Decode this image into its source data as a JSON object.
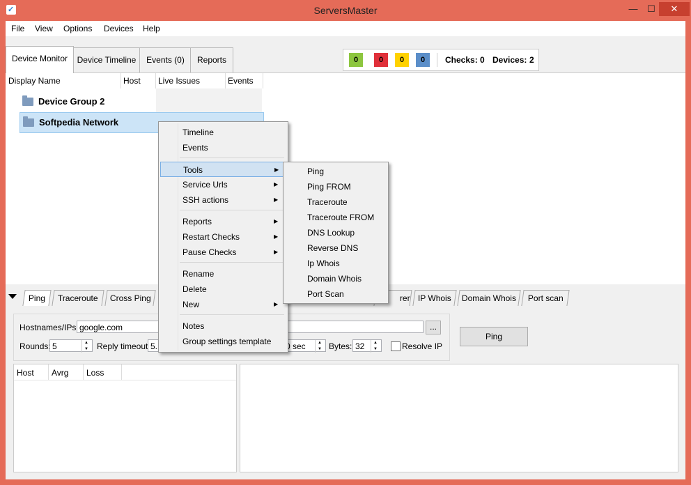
{
  "window": {
    "title": "ServersMaster"
  },
  "menubar": {
    "items": [
      "File",
      "View",
      "Options",
      "Devices",
      "Help"
    ]
  },
  "tabs": [
    {
      "label": "Device Monitor",
      "active": true
    },
    {
      "label": "Device Timeline",
      "active": false
    },
    {
      "label": "Events (0)",
      "active": false
    },
    {
      "label": "Reports",
      "active": false
    }
  ],
  "status": {
    "badges": [
      {
        "value": "0",
        "color": "#8dc63f"
      },
      {
        "value": "0",
        "color": "#e0303a"
      },
      {
        "value": "0",
        "color": "#ffd200"
      },
      {
        "value": "0",
        "color": "#5b8ec9"
      }
    ],
    "checks_label": "Checks:",
    "checks_value": "0",
    "devices_label": "Devices:",
    "devices_value": "2"
  },
  "tree": {
    "columns": [
      "Display Name",
      "Host",
      "Live Issues",
      "Events"
    ],
    "rows": [
      {
        "label": "Device Group 2",
        "selected": false
      },
      {
        "label": "Softpedia Network",
        "selected": true
      }
    ]
  },
  "context_menu": {
    "items": [
      "Timeline",
      "Events",
      "Tools",
      "Service Urls",
      "SSH actions",
      "Reports",
      "Restart Checks",
      "Pause Checks",
      "Rename",
      "Delete",
      "New",
      "Notes",
      "Group settings template"
    ],
    "highlighted": "Tools"
  },
  "tools_submenu": {
    "items": [
      "Ping",
      "Ping FROM",
      "Traceroute",
      "Traceroute FROM",
      "DNS Lookup",
      "Reverse DNS",
      "Ip Whois",
      "Domain Whois",
      "Port Scan"
    ]
  },
  "bottom_tabs": {
    "items": [
      "Ping",
      "Traceroute",
      "Cross Ping",
      "rer",
      "IP Whois",
      "Domain Whois",
      "Port scan"
    ],
    "active": "Ping"
  },
  "ping_form": {
    "hostnames_label": "Hostnames/IPs:",
    "hostnames_value": "google.com",
    "browse_label": "...",
    "rounds_label": "Rounds:",
    "rounds_value": "5",
    "reply_timeout_label": "Reply timeout:",
    "reply_timeout_value": "5.",
    "interval_value": "0 sec",
    "bytes_label": "Bytes:",
    "bytes_value": "32",
    "resolve_ip_label": "Resolve IP",
    "resolve_ip_checked": false,
    "ping_button": "Ping"
  },
  "results_table": {
    "columns": [
      "Host",
      "Avrg",
      "Loss"
    ]
  }
}
